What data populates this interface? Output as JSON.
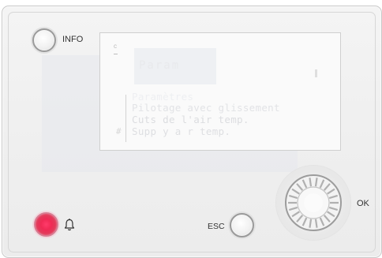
{
  "buttons": {
    "info_label": "INFO",
    "esc_label": "ESC",
    "ok_label": "OK"
  },
  "display": {
    "corner_glyph": "c",
    "title": "Param",
    "marker": "#",
    "menu": [
      "Paramètres",
      "Pilotage avec glissement",
      "Cuts de l'air temp.",
      "Supp y a r temp."
    ]
  },
  "icons": {
    "alarm": "bell-icon",
    "knob": "rotary-dial-icon"
  },
  "colors": {
    "alarm_led": "#f02a55",
    "panel": "#f0f0f0"
  }
}
